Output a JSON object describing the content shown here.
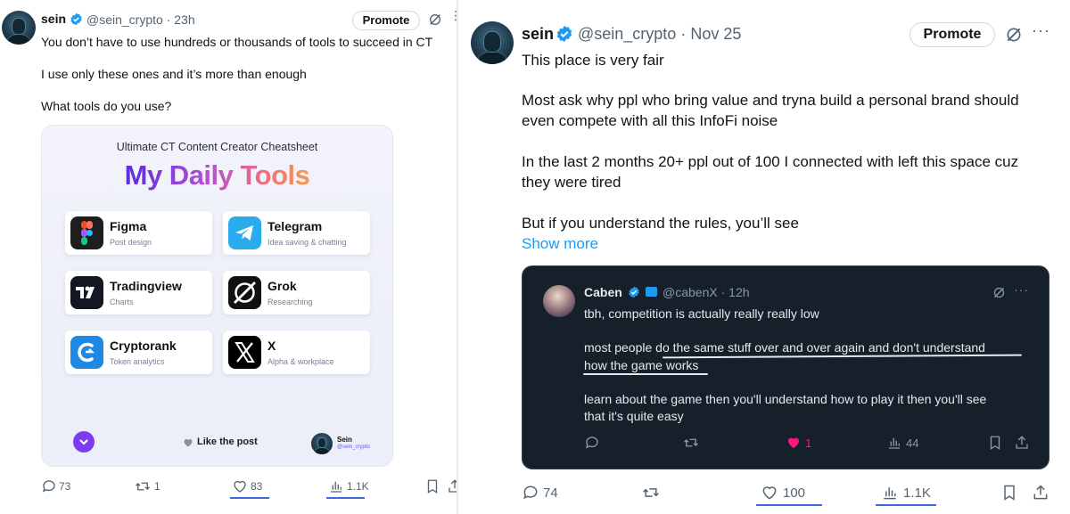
{
  "left_tweet": {
    "author": {
      "name": "sein",
      "handle": "@sein_crypto",
      "time": "23h"
    },
    "promote_label": "Promote",
    "text_lines": [
      "You don’t have to use hundreds or thousands of tools to succeed in CT",
      "I use only these ones and it’s more than enough",
      "What tools do you use?"
    ],
    "card": {
      "subtitle": "Ultimate CT Content Creator Cheatsheet",
      "title": "My Daily Tools",
      "tools": [
        {
          "name": "Figma",
          "desc": "Post design"
        },
        {
          "name": "Telegram",
          "desc": "Idea saving & chatting"
        },
        {
          "name": "Tradingview",
          "desc": "Charts"
        },
        {
          "name": "Grok",
          "desc": "Researching"
        },
        {
          "name": "Cryptorank",
          "desc": "Token analytics"
        },
        {
          "name": "X",
          "desc": "Alpha & workplace"
        }
      ],
      "like_label": "Like the post",
      "author_name": "Sein",
      "author_handle": "@sein_crypto"
    },
    "actions": {
      "replies": "73",
      "reposts": "1",
      "likes": "83",
      "views": "1.1K"
    }
  },
  "right_tweet": {
    "author": {
      "name": "sein",
      "handle": "@sein_crypto",
      "time": "Nov 25"
    },
    "promote_label": "Promote",
    "text_lines": [
      "This place is very fair",
      "Most ask why ppl who bring value and tryna build a personal brand should",
      "even compete with all this InfoFi noise",
      "In the last 2 months 20+ ppl out of 100 I connected with left this space cuz",
      "they were tired",
      "But if you understand the rules, you’ll see"
    ],
    "show_more": "Show more",
    "quoted": {
      "name": "Caben",
      "handle": "@cabenX",
      "time": "12h",
      "text_lines": [
        "tbh, competition is actually really really low",
        "most people do the same stuff over and over again and don't understand",
        "how the game works",
        "learn about the game then you'll understand how to play it then you'll see",
        "that it's quite easy"
      ],
      "actions": {
        "likes": "1",
        "views": "44"
      },
      "colors": {
        "background": "#15202b",
        "like": "#f91880"
      }
    },
    "actions": {
      "replies": "74",
      "likes": "100",
      "views": "1.1K"
    }
  },
  "colors": {
    "accent": "#1d9bf0",
    "verified": "#1d9bf0",
    "underline": "#1d4ed8"
  }
}
